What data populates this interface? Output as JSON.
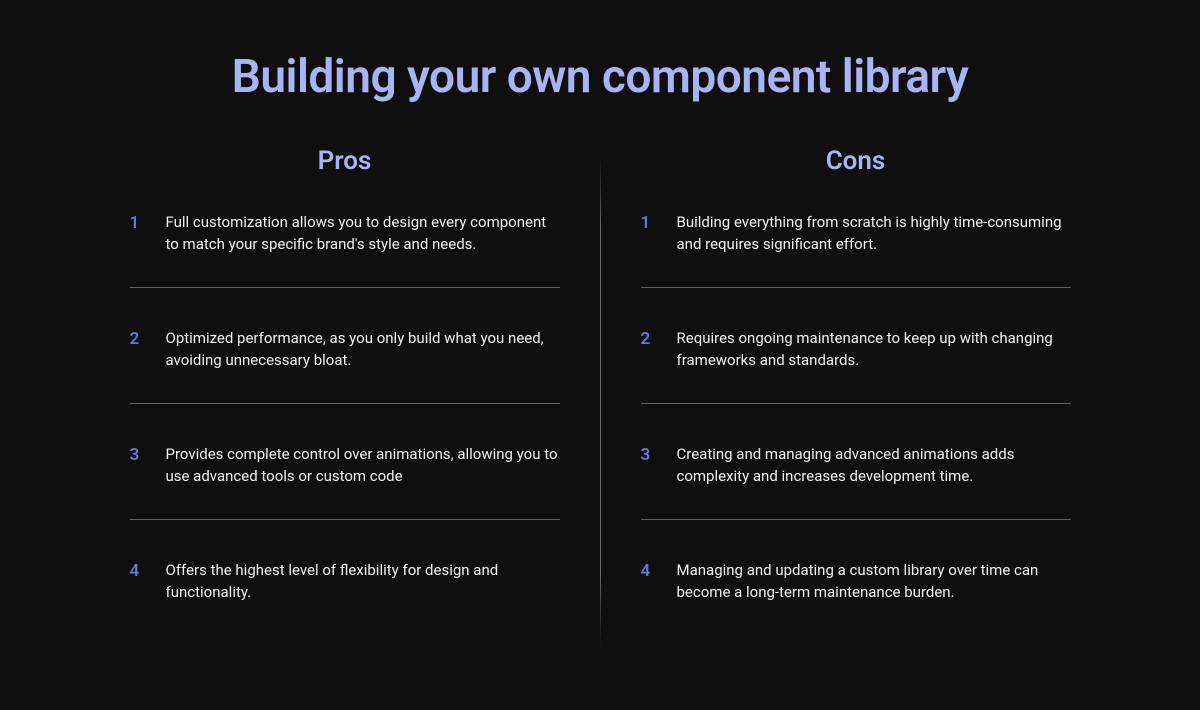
{
  "title": "Building your own component library",
  "pros": {
    "heading": "Pros",
    "items": [
      {
        "num": "1",
        "text": "Full customization allows you to design every component to match your specific brand's style and needs."
      },
      {
        "num": "2",
        "text": "Optimized performance, as you only build what you need, avoiding unnecessary bloat."
      },
      {
        "num": "3",
        "text": "Provides complete control over animations, allowing you to use advanced tools or custom code"
      },
      {
        "num": "4",
        "text": "Offers the highest level of flexibility for design and functionality."
      }
    ]
  },
  "cons": {
    "heading": "Cons",
    "items": [
      {
        "num": "1",
        "text": "Building everything from scratch is highly time-consuming and requires significant effort."
      },
      {
        "num": "2",
        "text": "Requires ongoing maintenance to keep up with changing frameworks and standards."
      },
      {
        "num": "3",
        "text": "Creating and managing advanced animations adds complexity and increases development time."
      },
      {
        "num": "4",
        "text": "Managing and updating a custom library over time can become a long-term maintenance burden."
      }
    ]
  }
}
